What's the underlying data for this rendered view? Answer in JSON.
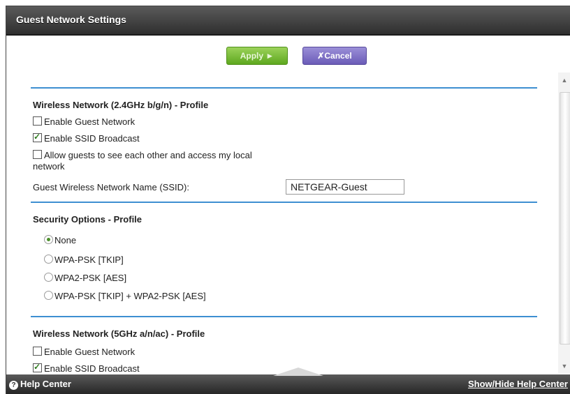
{
  "title": "Guest Network Settings",
  "toolbar": {
    "apply_label": "Apply ►",
    "cancel_label": "✗Cancel"
  },
  "wireless24": {
    "heading": "Wireless Network (2.4GHz b/g/n) - Profile",
    "enable_guest": {
      "label": "Enable Guest Network",
      "checked": false
    },
    "enable_ssid": {
      "label": "Enable SSID Broadcast",
      "checked": true
    },
    "allow_guests": {
      "label_line1": "Allow guests to see each other and access my local",
      "label_line2": "network",
      "checked": false
    },
    "ssid_label": "Guest Wireless Network Name (SSID):",
    "ssid_value": "NETGEAR-Guest"
  },
  "security": {
    "heading": "Security Options - Profile",
    "options": [
      {
        "label": "None",
        "selected": true
      },
      {
        "label": "WPA-PSK [TKIP]",
        "selected": false
      },
      {
        "label": "WPA2-PSK [AES]",
        "selected": false
      },
      {
        "label": "WPA-PSK [TKIP] + WPA2-PSK [AES]",
        "selected": false
      }
    ]
  },
  "wireless5": {
    "heading": "Wireless Network (5GHz a/n/ac) - Profile",
    "enable_guest": {
      "label": "Enable Guest Network",
      "checked": false
    },
    "enable_ssid": {
      "label": "Enable SSID Broadcast",
      "checked": true
    }
  },
  "helpbar": {
    "left": "Help Center",
    "right": "Show/Hide Help Center"
  },
  "colors": {
    "accent_rule": "#3d8fd1",
    "apply": "#6fb42c",
    "cancel": "#7a6cc4",
    "header": "#3a3a3a"
  }
}
